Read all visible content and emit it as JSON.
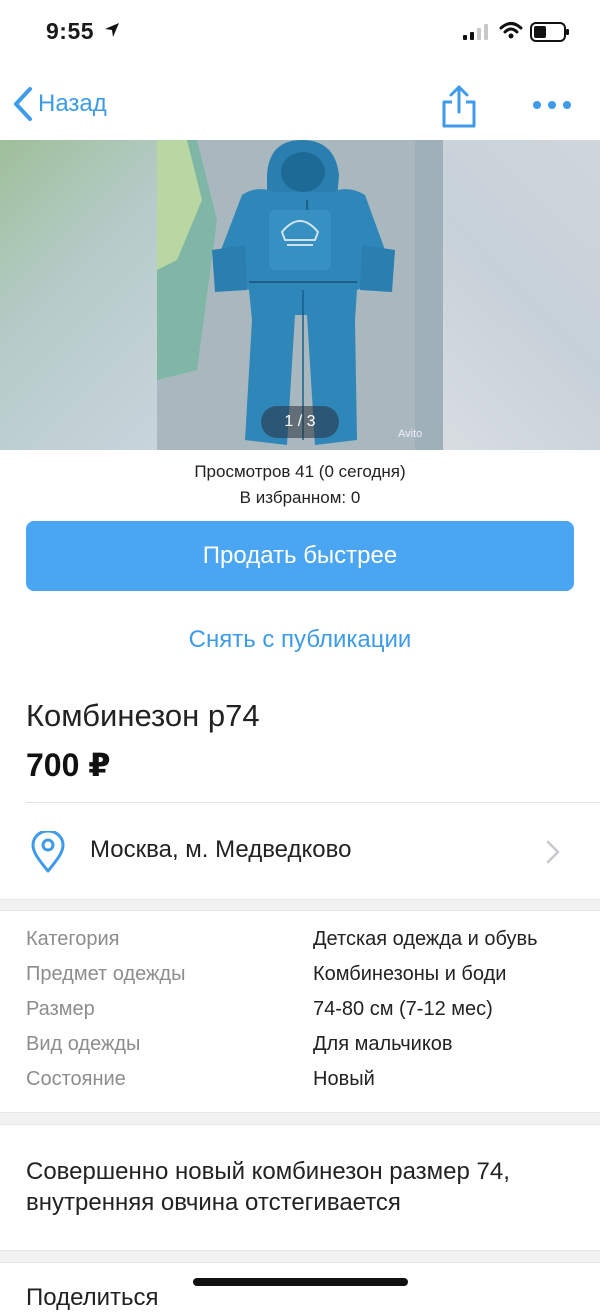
{
  "status_bar": {
    "time": "9:55"
  },
  "nav": {
    "back_label": "Назад"
  },
  "gallery": {
    "counter": "1 / 3",
    "watermark": "Avito"
  },
  "stats": {
    "views": "Просмотров 41 (0 сегодня)",
    "favorites": "В избранном: 0"
  },
  "actions": {
    "sell_faster": "Продать быстрее",
    "unpublish": "Снять с публикации"
  },
  "listing": {
    "title": "Комбинезон р74",
    "price": "700 ₽"
  },
  "location": {
    "text": "Москва, м. Медведково"
  },
  "params": [
    {
      "key": "Категория",
      "value": "Детская одежда и обувь"
    },
    {
      "key": "Предмет одежды",
      "value": "Комбинезоны и боди"
    },
    {
      "key": "Размер",
      "value": "74-80 см (7-12 мес)"
    },
    {
      "key": "Вид одежды",
      "value": "Для мальчиков"
    },
    {
      "key": "Состояние",
      "value": "Новый"
    }
  ],
  "description": "Совершенно новый комбинезон размер 74, внутренняя овчина отстегивается",
  "share_label": "Поделиться",
  "colors": {
    "accent": "#3d9bea",
    "button": "#4aa6f2",
    "product": "#2f86b8"
  }
}
